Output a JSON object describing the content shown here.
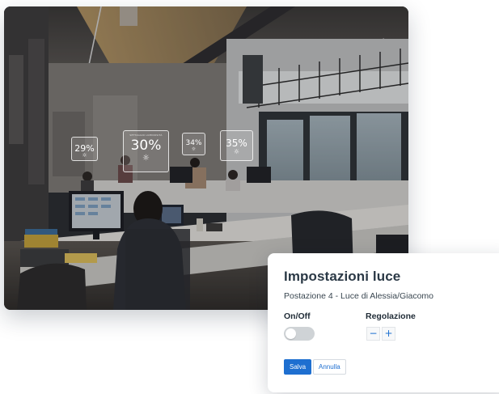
{
  "photo": {
    "badges": [
      {
        "caption": "",
        "value": "29%"
      },
      {
        "caption": "SETTAGGIO LUMINOSITÀ",
        "value": "30%"
      },
      {
        "caption": "",
        "value": "34%"
      },
      {
        "caption": "",
        "value": "35%"
      }
    ],
    "sun_glyph": "☼"
  },
  "settings_card": {
    "title": "Impostazioni luce",
    "subtitle": "Postazione 4 - Luce di Alessia/Giacomo",
    "onoff_label": "On/Off",
    "onoff_state": false,
    "regulation_label": "Regolazione",
    "minus_label": "−",
    "plus_label": "+",
    "save_label": "Salva",
    "cancel_label": "Annulla"
  },
  "colors": {
    "accent": "#1e6fd0",
    "title": "#2b3946",
    "toggle_off": "#cfd3d6"
  }
}
